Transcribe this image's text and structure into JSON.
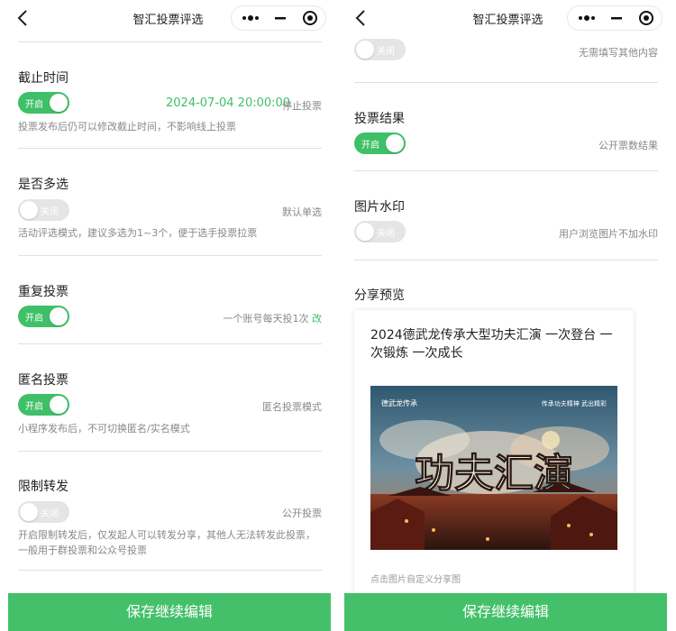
{
  "window": {
    "title": "智汇投票评选"
  },
  "colors": {
    "accent": "#3fc068",
    "button": "#45c06a",
    "toggle_off": "#e5e5e5"
  },
  "left": {
    "deadline": {
      "label": "截止时间",
      "toggle": "开启",
      "datetime": "2024-07-04  20:00:00",
      "right_hint": "停止投票",
      "desc": "投票发布后仍可以修改截止时间，不影响线上投票"
    },
    "multi": {
      "label": "是否多选",
      "toggle": "关闭",
      "right_hint": "默认单选",
      "desc": "活动评选模式，建议多选为1~3个，便于选手投票拉票"
    },
    "repeat": {
      "label": "重复投票",
      "toggle": "开启",
      "right_hint": "一个账号每天投1次",
      "right_link": "改"
    },
    "anonymous": {
      "label": "匿名投票",
      "toggle": "开启",
      "right_hint": "匿名投票模式",
      "desc": "小程序发布后，不可切换匿名/实名模式"
    },
    "forward": {
      "label": "限制转发",
      "toggle": "关闭",
      "right_hint": "公开投票",
      "desc": "开启限制转发后，仅发起人可以转发分享，其他人无法转发此投票，一般用于群投票和公众号投票"
    },
    "save_button": "保存继续编辑"
  },
  "right": {
    "extra": {
      "toggle": "关闭",
      "right_hint": "无需填写其他内容"
    },
    "result": {
      "label": "投票结果",
      "toggle": "开启",
      "right_hint": "公开票数结果"
    },
    "watermark": {
      "label": "图片水印",
      "toggle": "关闭",
      "right_hint": "用户浏览图片不加水印"
    },
    "share": {
      "label": "分享预览",
      "title": "2024德武龙传承大型功夫汇演 一次登台 一次锻炼 一次成长",
      "footer": "点击图片自定义分享图",
      "poster_big_text": "功夫汇演",
      "poster_logo": "德武龙传承",
      "poster_side_text": "传承功夫精神 武出精彩"
    },
    "save_button": "保存继续编辑"
  }
}
